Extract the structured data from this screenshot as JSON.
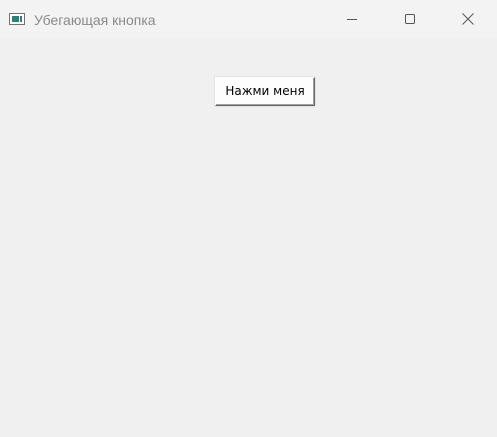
{
  "window": {
    "title": "Убегающая кнопка",
    "icon": "app-window-icon",
    "controls": [
      "minimize-icon",
      "maximize-icon",
      "close-icon"
    ]
  },
  "main": {
    "button_label": "Нажми меня"
  }
}
